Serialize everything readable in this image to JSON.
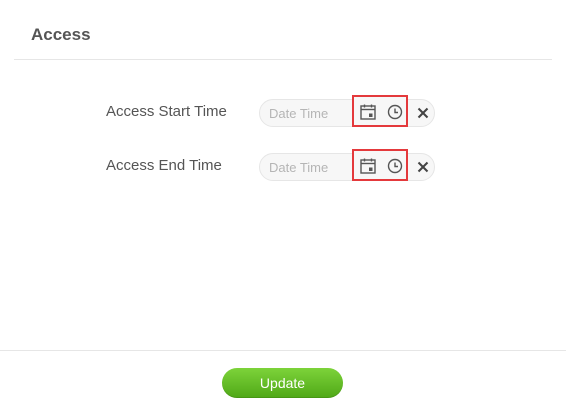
{
  "header": {
    "title": "Access"
  },
  "fields": {
    "start": {
      "label": "Access Start Time",
      "placeholder": "Date Time",
      "value": ""
    },
    "end": {
      "label": "Access End Time",
      "placeholder": "Date Time",
      "value": ""
    }
  },
  "icons": {
    "calendar": "calendar-icon",
    "clock": "clock-icon",
    "clear": "close-icon"
  },
  "colors": {
    "accent_green": "#5cb82a",
    "highlight_red": "#e4393c",
    "text": "#555555"
  },
  "footer": {
    "update_label": "Update"
  }
}
